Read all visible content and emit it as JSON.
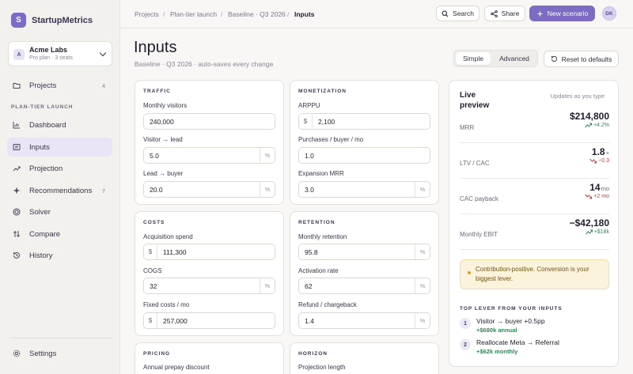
{
  "app": {
    "name": "StartupMetrics",
    "logo_letter": "S"
  },
  "org": {
    "avatar": "A",
    "name": "Acme Labs",
    "plan": "Pro plan · 3 seats"
  },
  "sidebar": {
    "projects": {
      "label": "Projects",
      "count": "4",
      "icon": "folder-icon"
    },
    "section_label": "PLAN-TIER LAUNCH",
    "items": [
      {
        "label": "Dashboard",
        "icon": "chart-icon"
      },
      {
        "label": "Inputs",
        "icon": "input-icon"
      },
      {
        "label": "Projection",
        "icon": "trend-icon"
      },
      {
        "label": "Recommendations",
        "icon": "sparkle-icon",
        "count": "7"
      },
      {
        "label": "Solver",
        "icon": "target-icon"
      },
      {
        "label": "Compare",
        "icon": "compare-icon"
      },
      {
        "label": "History",
        "icon": "history-icon"
      }
    ],
    "settings": {
      "label": "Settings",
      "icon": "gear-icon"
    }
  },
  "breadcrumb": [
    "Projects",
    "Plan-tier launch",
    "Baseline · Q3 2026",
    "Inputs"
  ],
  "topbar": {
    "search": "Search",
    "share": "Share",
    "new_scenario": "New scenario",
    "user_initials": "DK"
  },
  "page": {
    "title": "Inputs",
    "subtitle": "Baseline · Q3 2026 · auto-saves every change",
    "mode_simple": "Simple",
    "mode_advanced": "Advanced",
    "reset": "Reset to defaults"
  },
  "traffic": {
    "title": "TRAFFIC",
    "monthly_visitors": {
      "label": "Monthly visitors",
      "value": "240,000"
    },
    "visitor_lead": {
      "label": "Visitor → lead",
      "value": "5.0",
      "suffix": "%"
    },
    "lead_buyer": {
      "label": "Lead → buyer",
      "value": "20.0",
      "suffix": "%"
    }
  },
  "monetization": {
    "title": "MONETIZATION",
    "arppu": {
      "label": "ARPPU",
      "prefix": "$",
      "value": "2,100"
    },
    "purchases": {
      "label": "Purchases / buyer / mo",
      "value": "1.0"
    },
    "expansion": {
      "label": "Expansion MRR",
      "value": "3.0",
      "suffix": "%"
    }
  },
  "costs": {
    "title": "COSTS",
    "acquisition": {
      "label": "Acquisition spend",
      "prefix": "$",
      "value": "111,300"
    },
    "cogs": {
      "label": "COGS",
      "value": "32",
      "suffix": "%"
    },
    "fixed": {
      "label": "Fixed costs / mo",
      "prefix": "$",
      "value": "257,000"
    }
  },
  "retention": {
    "title": "RETENTION",
    "monthly": {
      "label": "Monthly retention",
      "value": "95.8",
      "suffix": "%"
    },
    "activation": {
      "label": "Activation rate",
      "value": "62",
      "suffix": "%"
    },
    "refund": {
      "label": "Refund / chargeback",
      "value": "1.4",
      "suffix": "%"
    }
  },
  "pricing": {
    "title": "PRICING",
    "annual_prepay": {
      "label": "Annual prepay discount"
    }
  },
  "horizon": {
    "title": "HORIZON",
    "projection_length": {
      "label": "Projection length"
    }
  },
  "preview": {
    "title": "Live preview",
    "updates": "Updates as you type",
    "metrics": [
      {
        "label": "MRR",
        "value": "$214,800",
        "unit": "",
        "delta": "+4.2%",
        "direction": "up"
      },
      {
        "label": "LTV / CAC",
        "value": "1.8",
        "unit": "×",
        "delta": "−0.3",
        "direction": "down"
      },
      {
        "label": "CAC payback",
        "value": "14",
        "unit": "mo",
        "delta": "+2 mo",
        "direction": "down"
      },
      {
        "label": "Monthly EBIT",
        "value": "−$42,180",
        "unit": "",
        "delta": "+$18k",
        "direction": "up"
      }
    ],
    "callout": "Contribution-positive. Conversion is your biggest lever.",
    "levers_title": "TOP LEVER FROM YOUR INPUTS",
    "levers": [
      {
        "num": "1",
        "main": "Visitor → buyer +0.5pp",
        "impact": "+$680k annual"
      },
      {
        "num": "2",
        "main": "Reallocate Meta → Referral",
        "impact": "+$62k monthly"
      }
    ]
  },
  "colors": {
    "accent": "#7e6bc4",
    "positive": "#2e8a57",
    "negative": "#c7403a",
    "callout_bg": "#fbf3dc"
  }
}
